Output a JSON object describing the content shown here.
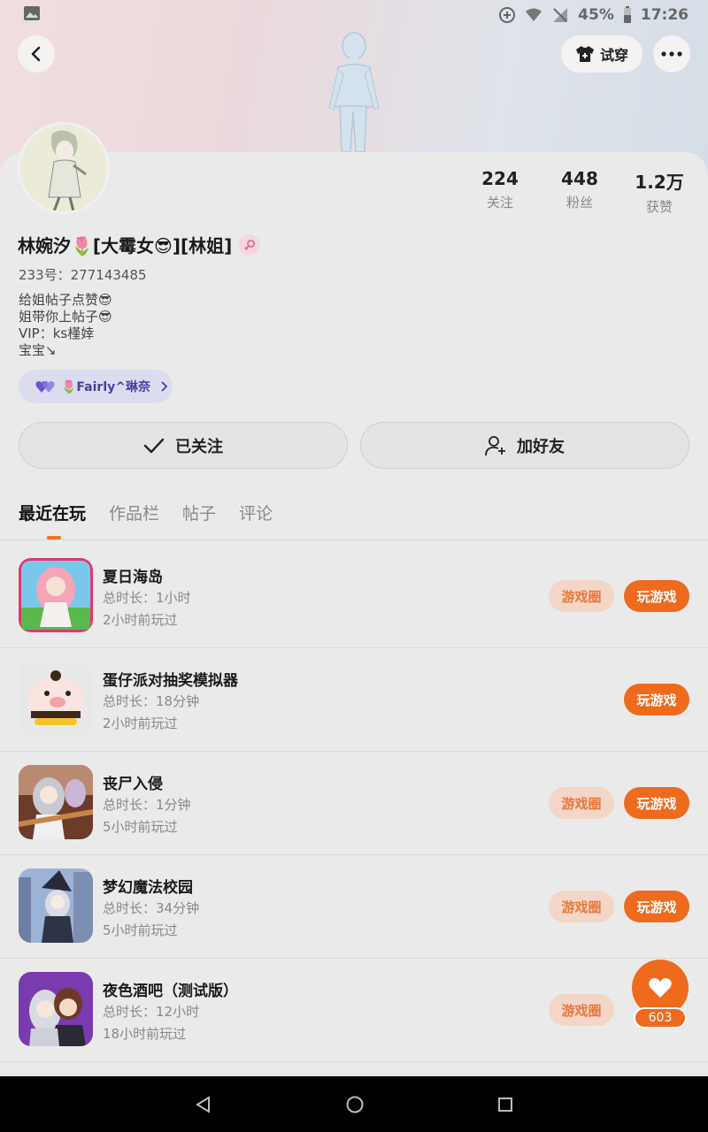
{
  "status_bar": {
    "battery": "45%",
    "time": "17:26"
  },
  "header": {
    "try_on_label": "试穿"
  },
  "profile": {
    "name": "林婉汐🌷[大霉女😎][林姐]",
    "uid_label": "233号：",
    "uid": "277143485",
    "bio": [
      "给姐帖子点赞😎",
      "姐带你上帖子😎",
      "VIP：ks槿婞",
      "宝宝↘"
    ],
    "club_name": "🌷Fairly^琳奈"
  },
  "stats": [
    {
      "value": "224",
      "label": "关注"
    },
    {
      "value": "448",
      "label": "粉丝"
    },
    {
      "value": "1.2万",
      "label": "获赞"
    }
  ],
  "actions": {
    "follow_label": "已关注",
    "add_friend_label": "加好友"
  },
  "tabs": [
    {
      "label": "最近在玩",
      "active": true
    },
    {
      "label": "作品栏",
      "active": false
    },
    {
      "label": "帖子",
      "active": false
    },
    {
      "label": "评论",
      "active": false
    }
  ],
  "games": [
    {
      "title": "夏日海岛",
      "duration": "总时长：1小时",
      "last_played": "2小时前玩过",
      "circle_label": "游戏圈",
      "play_label": "玩游戏"
    },
    {
      "title": "蛋仔派对抽奖模拟器",
      "duration": "总时长：18分钟",
      "last_played": "2小时前玩过",
      "circle_label": "",
      "play_label": "玩游戏"
    },
    {
      "title": "丧尸入侵",
      "duration": "总时长：1分钟",
      "last_played": "5小时前玩过",
      "circle_label": "游戏圈",
      "play_label": "玩游戏"
    },
    {
      "title": "梦幻魔法校园",
      "duration": "总时长：34分钟",
      "last_played": "5小时前玩过",
      "circle_label": "游戏圈",
      "play_label": "玩游戏"
    },
    {
      "title": "夜色酒吧（测试版）",
      "duration": "总时长：12小时",
      "last_played": "18小时前玩过",
      "circle_label": "游戏圈",
      "play_label": ""
    }
  ],
  "like_float": {
    "count": "603"
  },
  "colors": {
    "accent": "#ee6a1d",
    "accent_light": "#f3d6c7"
  }
}
